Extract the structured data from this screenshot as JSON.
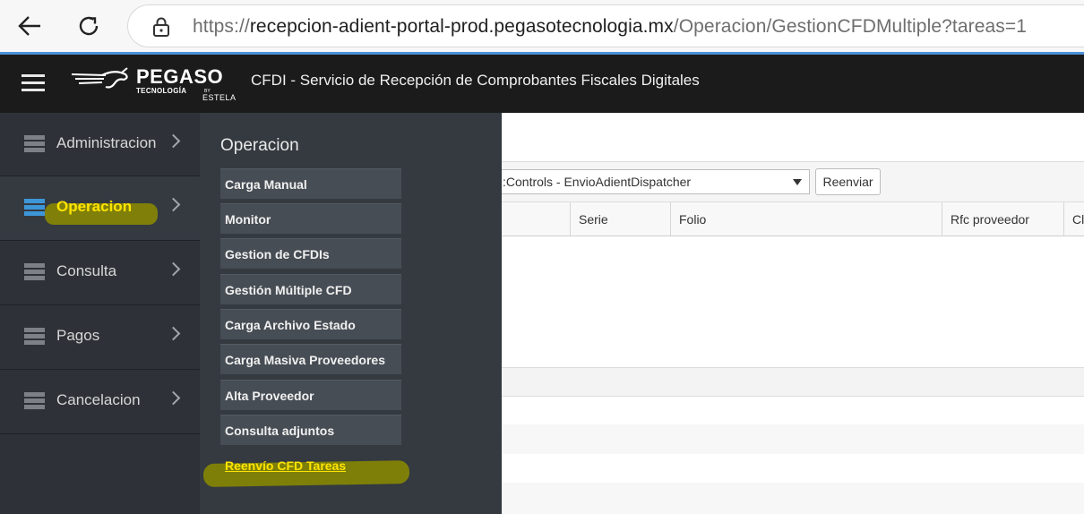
{
  "browser": {
    "url_scheme": "https://",
    "url_host": "recepcion-adient-portal-prod.pegasotecnologia.mx",
    "url_path": "/Operacion/GestionCFDMultiple?tareas=1"
  },
  "header": {
    "logo_name": "PEGASO",
    "logo_sub": "TECNOLOGÍA",
    "logo_by": "BY",
    "logo_estela": "ESTELA",
    "title": "CFDI - Servicio de Recepción de Comprobantes Fiscales Digitales"
  },
  "sidebar": {
    "items": [
      {
        "label": "Administracion",
        "icon": "server-icon"
      },
      {
        "label": "Operacion",
        "icon": "server-icon",
        "active": true
      },
      {
        "label": "Consulta",
        "icon": "server-icon"
      },
      {
        "label": "Pagos",
        "icon": "server-icon"
      },
      {
        "label": "Cancelacion",
        "icon": "server-icon"
      }
    ]
  },
  "submenu": {
    "title": "Operacion",
    "items": [
      "Carga Manual",
      "Monitor",
      "Gestion de CFDIs",
      "Gestión Múltiple CFD",
      "Carga Archivo Estado",
      "Carga Masiva Proveedores",
      "Alta Proveedor",
      "Consulta adjuntos",
      "Reenvío CFD Tareas"
    ],
    "highlighted_item": "Reenvío CFD Tareas"
  },
  "content": {
    "select_value": ":Controls - EnvioAdientDispatcher",
    "resend_label": "Reenviar",
    "columns": [
      "",
      "Serie",
      "Folio",
      "Rfc proveedor",
      "Cl"
    ]
  },
  "colors": {
    "sidebar_bg": "#2e3238",
    "submenu_bg": "#343a40",
    "header_bg": "#1b1b1b",
    "active_text": "#ffe400",
    "active_icon": "#3d96d8"
  }
}
